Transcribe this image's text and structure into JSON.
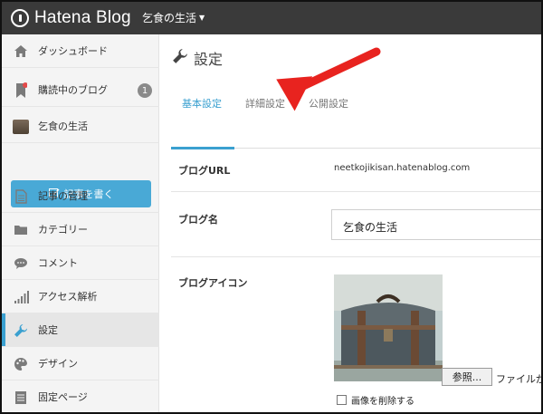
{
  "header": {
    "logo_text": "Hatena Blog",
    "blog_name": "乞食の生活"
  },
  "sidebar": {
    "items": [
      {
        "label": "ダッシュボード"
      },
      {
        "label": "購読中のブログ",
        "badge": "1"
      },
      {
        "label": "乞食の生活"
      },
      {
        "label": "記事の管理"
      },
      {
        "label": "カテゴリー"
      },
      {
        "label": "コメント"
      },
      {
        "label": "アクセス解析"
      },
      {
        "label": "設定"
      },
      {
        "label": "デザイン"
      },
      {
        "label": "固定ページ"
      }
    ],
    "write_button": "記事を書く"
  },
  "main": {
    "title": "設定",
    "tabs": [
      "基本設定",
      "詳細設定",
      "公開設定"
    ],
    "rows": {
      "url_label": "ブログURL",
      "url_value": "neetkojikisan.hatenablog.com",
      "name_label": "ブログ名",
      "name_value": "乞食の生活",
      "icon_label": "ブログアイコン"
    },
    "browse_button": "参照...",
    "file_text": "ファイルが",
    "delete_image_label": "画像を削除する"
  },
  "colors": {
    "accent": "#3aa0d0",
    "topbar": "#3a3a3a",
    "arrow": "#e8231f"
  }
}
